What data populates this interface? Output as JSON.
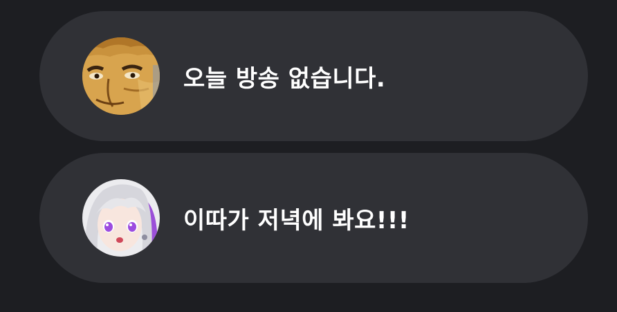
{
  "messages": [
    {
      "avatar": "man-face-avatar",
      "text": "오늘 방송 없습니다."
    },
    {
      "avatar": "anime-girl-avatar",
      "text": "이따가 저녁에 봐요!!!"
    }
  ],
  "colors": {
    "background": "#1d1e22",
    "bubble": "#303136",
    "text": "#ffffff"
  }
}
